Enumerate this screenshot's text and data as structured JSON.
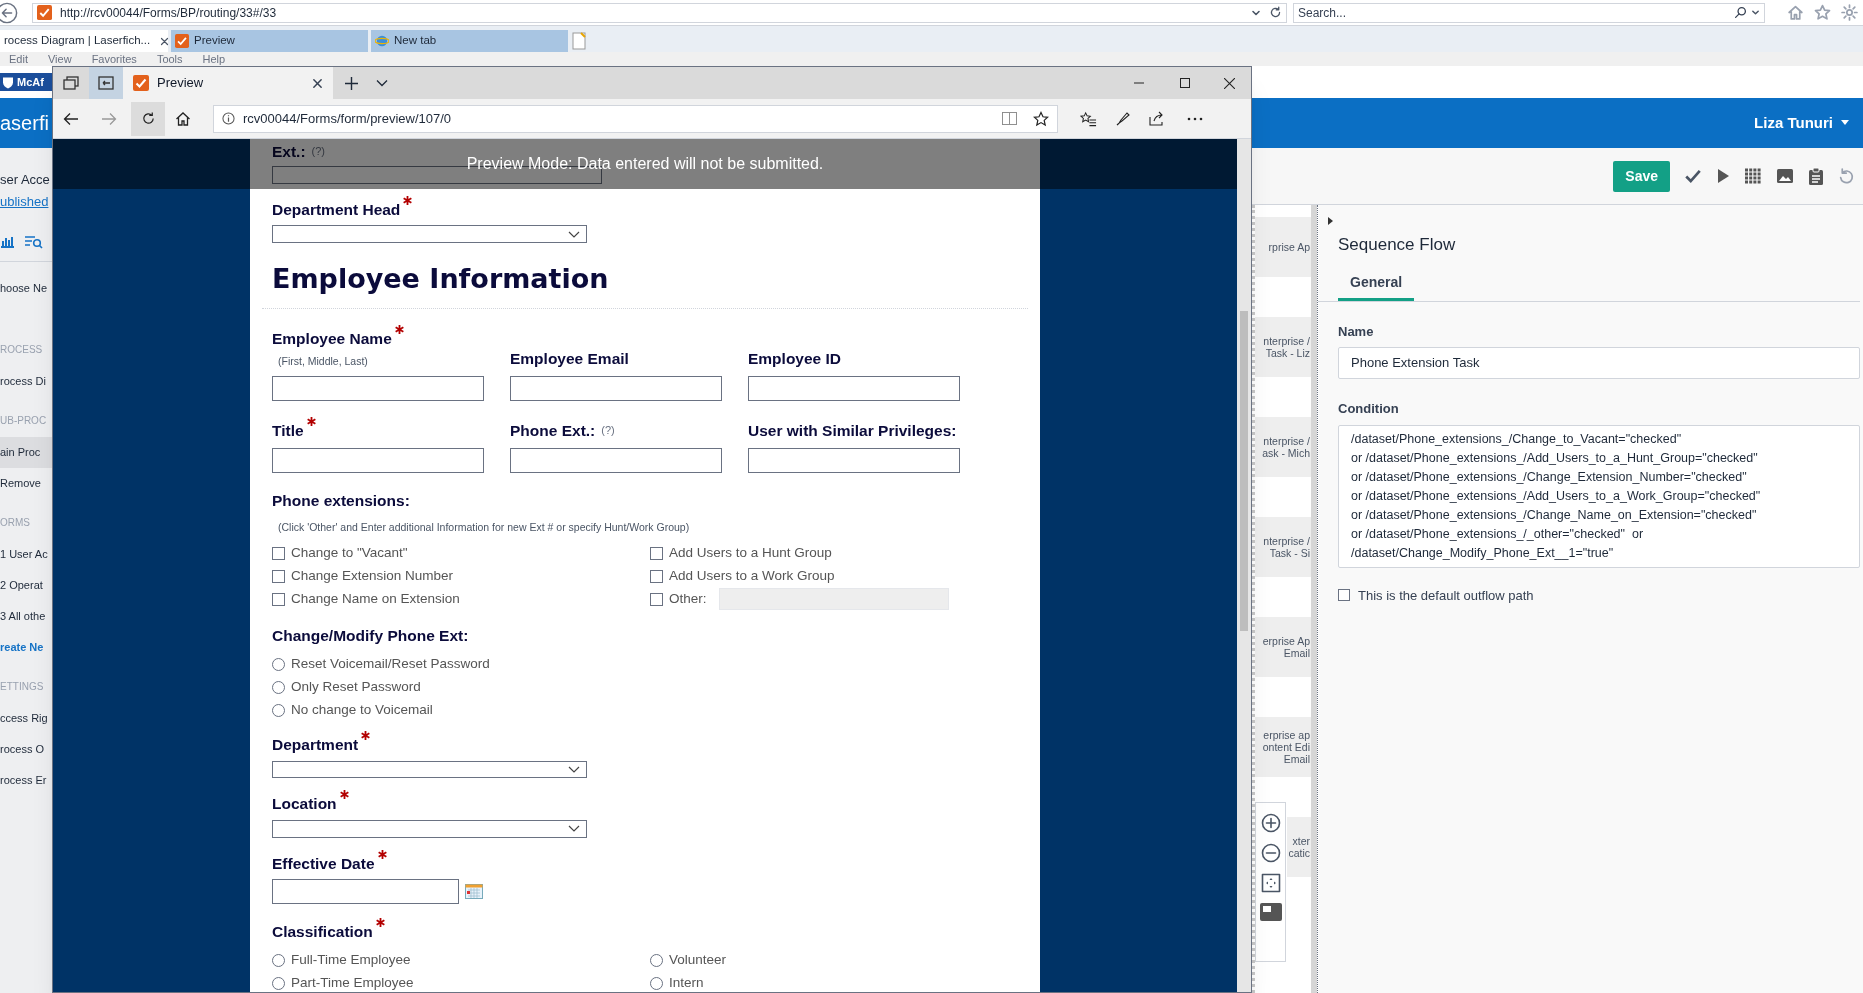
{
  "ie": {
    "address": "http://rcv00044/Forms/BP/routing/33#/33",
    "search_placeholder": "Search...",
    "tabs": [
      {
        "label": "rocess Diagram | Laserfich...",
        "selected": true,
        "closable": true
      },
      {
        "label": "Preview",
        "selected": false,
        "closable": false
      },
      {
        "label": "New tab",
        "selected": false,
        "closable": false
      }
    ],
    "menu": [
      "Edit",
      "View",
      "Favorites",
      "Tools",
      "Help"
    ]
  },
  "laserfiche": {
    "mcafee": "McAf",
    "brand": "aserfi",
    "user": "Liza Tunuri",
    "sidebar": [
      {
        "label": "ser Acce",
        "kind": "title"
      },
      {
        "label": "ublished",
        "kind": "link"
      },
      {
        "kind": "tools"
      },
      {
        "label": "hoose Ne",
        "kind": "text"
      },
      {
        "label": "ROCESS",
        "kind": "heading"
      },
      {
        "label": "rocess Di",
        "kind": "item",
        "selected": false
      },
      {
        "label": "UB-PROC",
        "kind": "heading"
      },
      {
        "label": "ain Proc",
        "kind": "item",
        "selected": true
      },
      {
        "label": "Remove",
        "kind": "item",
        "selected": false
      },
      {
        "label": "ORMS",
        "kind": "heading"
      },
      {
        "label": "1 User Ac",
        "kind": "item",
        "selected": false
      },
      {
        "label": "2 Operat",
        "kind": "item",
        "selected": false
      },
      {
        "label": "3 All othe",
        "kind": "item",
        "selected": false
      },
      {
        "label": "reate Ne",
        "kind": "action"
      },
      {
        "label": "ETTINGS",
        "kind": "heading"
      },
      {
        "label": "ccess Rig",
        "kind": "item",
        "selected": false
      },
      {
        "label": "rocess O",
        "kind": "item",
        "selected": false
      },
      {
        "label": "rocess Er",
        "kind": "item",
        "selected": false
      }
    ],
    "save": "Save",
    "canvas_nodes": [
      {
        "lines": [
          "rprise Ap"
        ]
      },
      {
        "lines": [
          "nterprise /",
          "Task - Liz"
        ]
      },
      {
        "lines": [
          "nterprise /",
          "ask - Mich"
        ]
      },
      {
        "lines": [
          "nterprise /",
          "Task - Si"
        ]
      },
      {
        "lines": [
          "erprise Ap",
          "Email"
        ]
      },
      {
        "lines": [
          "erprise ap",
          "ontent Edi",
          "Email"
        ]
      },
      {
        "lines": [
          "xter",
          "catic"
        ]
      }
    ],
    "properties": {
      "title": "Sequence Flow",
      "tabs": [
        {
          "label": "General",
          "selected": true
        }
      ],
      "name_label": "Name",
      "name_value": "Phone Extension Task",
      "condition_label": "Condition",
      "condition_lines": [
        "/dataset/Phone_extensions_/Change_to_Vacant=\"checked\"",
        "or /dataset/Phone_extensions_/Add_Users_to_a_Hunt_Group=\"checked\"",
        "or /dataset/Phone_extensions_/Change_Extension_Number=\"checked\"",
        "or /dataset/Phone_extensions_/Add_Users_to_a_Work_Group=\"checked\"",
        "or /dataset/Phone_extensions_/Change_Name_on_Extension=\"checked\"",
        "or /dataset/Phone_extensions_/_other=\"checked\"  or",
        "/dataset/Change_Modify_Phone_Ext__1=\"true\""
      ],
      "default_path": {
        "label": "This is the default outflow path",
        "checked": false
      }
    }
  },
  "preview": {
    "tab": "Preview",
    "address": "rcv00044/Forms/form/preview/107/0",
    "banner": "Preview Mode: Data entered will not be submitted.",
    "form": [
      {
        "kind": "text",
        "label": "Ext.:",
        "help": "(?)",
        "required": false
      },
      {
        "kind": "select",
        "label": "Department Head",
        "required": true
      },
      {
        "kind": "heading",
        "text": "Employee Information"
      },
      {
        "kind": "row",
        "fields": [
          {
            "label": "Employee Name",
            "required": true,
            "note": "(First, Middle, Last)"
          },
          {
            "label": "Employee Email",
            "required": false
          },
          {
            "label": "Employee ID",
            "required": false
          }
        ]
      },
      {
        "kind": "row",
        "fields": [
          {
            "label": "Title",
            "required": true
          },
          {
            "label": "Phone Ext.:",
            "required": false,
            "help": "(?)"
          },
          {
            "label": "User with Similar Privileges:",
            "required": false
          }
        ]
      },
      {
        "kind": "checkbox_grid",
        "label": "Phone extensions:",
        "required": false,
        "note": "(Click 'Other' and Enter additional Information for new Ext # or specify Hunt/Work Group)",
        "options": [
          {
            "label": "Change to \"Vacant\"",
            "checked": false
          },
          {
            "label": "Add Users to a Hunt Group",
            "checked": false
          },
          {
            "label": "Change Extension Number",
            "checked": false
          },
          {
            "label": "Add Users to a Work Group",
            "checked": false
          },
          {
            "label": "Change Name on Extension",
            "checked": false
          },
          {
            "label": "Other:",
            "checked": false,
            "kind": "other"
          }
        ]
      },
      {
        "kind": "radio_list",
        "label": "Change/Modify Phone Ext:",
        "required": false,
        "options": [
          {
            "label": "Reset Voicemail/Reset Password",
            "selected": false
          },
          {
            "label": "Only Reset Password",
            "selected": false
          },
          {
            "label": "No change to Voicemail",
            "selected": false
          }
        ]
      },
      {
        "kind": "select",
        "label": "Department",
        "required": true
      },
      {
        "kind": "select",
        "label": "Location",
        "required": true
      },
      {
        "kind": "date",
        "label": "Effective Date",
        "required": true
      },
      {
        "kind": "radio_grid",
        "label": "Classification",
        "required": true,
        "options": [
          {
            "label": "Full-Time Employee",
            "selected": false
          },
          {
            "label": "Volunteer",
            "selected": false
          },
          {
            "label": "Part-Time Employee",
            "selected": false
          },
          {
            "label": "Intern",
            "selected": false
          }
        ]
      }
    ]
  }
}
